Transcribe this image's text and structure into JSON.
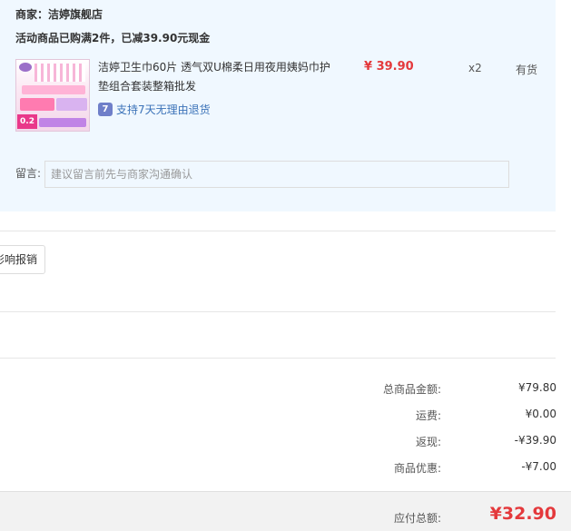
{
  "order": {
    "shop": "商家：洁婷旗舰店",
    "promotion": "活动商品已购满2件，已减39.90元现金",
    "item": {
      "title": "洁婷卫生巾60片 透气双U棉柔日用夜用姨妈巾护垫组合套装整箱批发",
      "thumb_price": "0.2",
      "return_badge_icon": "7",
      "return_policy": "支持7天无理由退货",
      "price": "¥ 39.90",
      "quantity": "x2",
      "stock": "有货"
    },
    "remark": {
      "label": "留言:",
      "placeholder": "建议留言前先与商家沟通确认",
      "value": ""
    }
  },
  "invoice": {
    "button_label": "影响报销"
  },
  "summary": {
    "rows": [
      {
        "label": "总商品金额:",
        "value": "¥79.80"
      },
      {
        "label": "运费:",
        "value": "¥0.00"
      },
      {
        "label": "返现:",
        "value": "-¥39.90"
      },
      {
        "label": "商品优惠:",
        "value": "-¥7.00"
      }
    ],
    "payable_label": "应付总额:",
    "payable_value": "¥32.90"
  },
  "colors": {
    "accent_red": "#e4393c",
    "panel_bg": "#f0f8ff",
    "link_blue": "#3b72b8"
  }
}
